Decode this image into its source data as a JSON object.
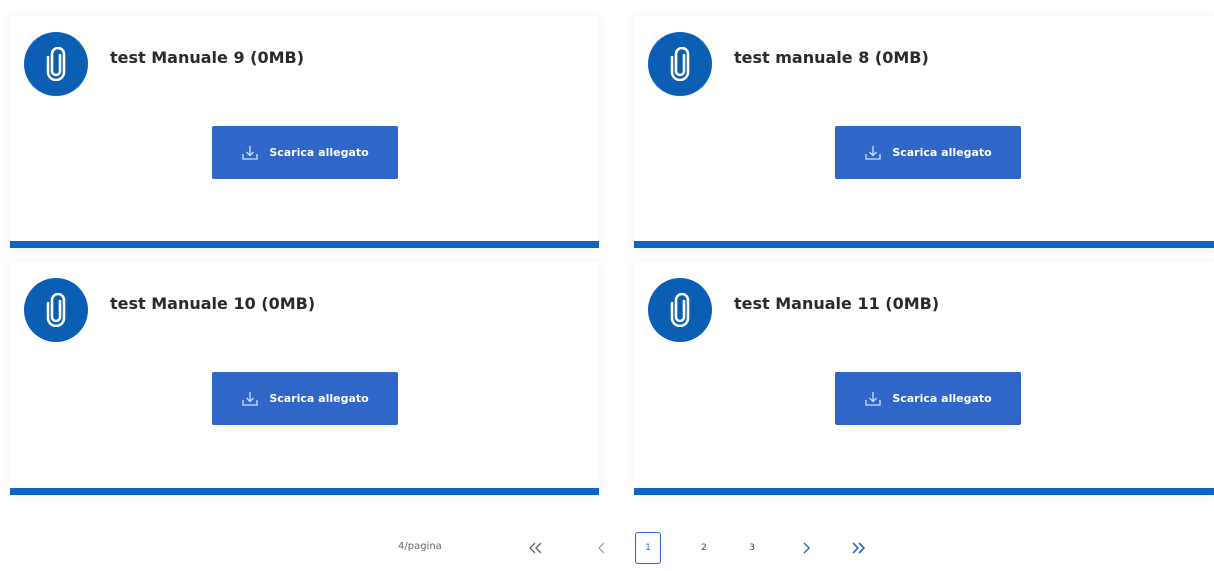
{
  "attachments": [
    {
      "title": "test Manuale 9 (0MB)",
      "button_label": "Scarica allegato"
    },
    {
      "title": "test manuale 8 (0MB)",
      "button_label": "Scarica allegato"
    },
    {
      "title": "test Manuale 10 (0MB)",
      "button_label": "Scarica allegato"
    },
    {
      "title": "test Manuale 11 (0MB)",
      "button_label": "Scarica allegato"
    }
  ],
  "pagination": {
    "per_page_label": "4/pagina",
    "pages": [
      "1",
      "2",
      "3"
    ],
    "current_page": "1"
  },
  "colors": {
    "accent": "#0b66c3",
    "button": "#2f66c8",
    "icon_circle": "#0a5fb4"
  },
  "icons": {
    "attachment": "paperclip-icon",
    "download": "download-icon",
    "first_page": "double-chevron-left-icon",
    "prev_page": "chevron-left-icon",
    "next_page": "chevron-right-icon",
    "last_page": "double-chevron-right-icon"
  }
}
